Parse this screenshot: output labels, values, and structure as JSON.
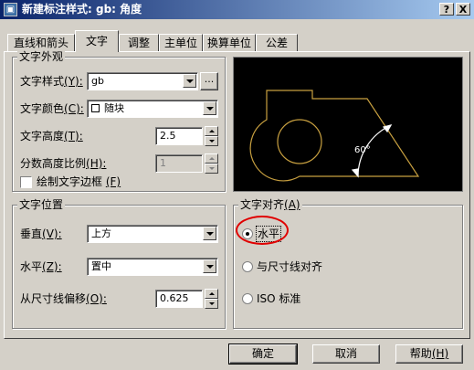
{
  "window": {
    "title": "新建标注样式: gb: 角度",
    "app_icon": "autocad-app-icon",
    "help_glyph": "?",
    "close_glyph": "X"
  },
  "tabs": [
    {
      "label": "直线和箭头"
    },
    {
      "label": "文字",
      "active": true
    },
    {
      "label": "调整"
    },
    {
      "label": "主单位"
    },
    {
      "label": "换算单位"
    },
    {
      "label": "公差"
    }
  ],
  "text_appearance": {
    "title": "文字外观",
    "style_label": "文字样式",
    "style_key": "(Y):",
    "style_value": "gb",
    "browse_label": "...",
    "color_label": "文字颜色",
    "color_key": "(C):",
    "color_value": "随块",
    "height_label": "文字高度",
    "height_key": "(T):",
    "height_value": "2.5",
    "fraction_label": "分数高度比例",
    "fraction_key": "(H):",
    "fraction_value": "1",
    "frame_label": "绘制文字边框",
    "frame_key": "(F)",
    "frame_checked": false
  },
  "text_placement": {
    "title": "文字位置",
    "vertical_label": "垂直",
    "vertical_key": "(V):",
    "vertical_value": "上方",
    "horizontal_label": "水平",
    "horizontal_key": "(Z):",
    "horizontal_value": "置中",
    "offset_label": "从尺寸线偏移",
    "offset_key": "(O):",
    "offset_value": "0.625"
  },
  "text_alignment": {
    "title": "文字对齐",
    "title_key": "(A)",
    "options": [
      {
        "label": "水平",
        "selected": true
      },
      {
        "label": "与尺寸线对齐",
        "selected": false
      },
      {
        "label": "ISO 标准",
        "selected": false
      }
    ]
  },
  "preview": {
    "angle_label": "60°",
    "line_color": "#c8a040",
    "text_color": "#ffffff"
  },
  "annotation": {
    "color": "#e00000"
  },
  "buttons": {
    "ok": "确定",
    "cancel": "取消",
    "help": "帮助",
    "help_key": "(H)"
  }
}
